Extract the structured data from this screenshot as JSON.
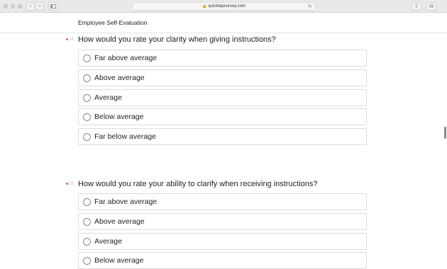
{
  "browser": {
    "url": "quicktapsurvey.com",
    "lock_icon": "lock-icon",
    "back_label": "‹",
    "forward_label": "›"
  },
  "page": {
    "title": "Employee Self-Evaluation"
  },
  "questions": [
    {
      "number": "14",
      "text": "How would you rate your clarity when giving instructions?",
      "options": [
        "Far above average",
        "Above average",
        "Average",
        "Below average",
        "Far below average"
      ]
    },
    {
      "number": "15",
      "text": "How would you rate your ability to clarify when receiving instructions?",
      "options": [
        "Far above average",
        "Above average",
        "Average",
        "Below average"
      ]
    }
  ],
  "colors": {
    "required_marker": "#e35b5b",
    "option_border": "#dcdcdc"
  }
}
